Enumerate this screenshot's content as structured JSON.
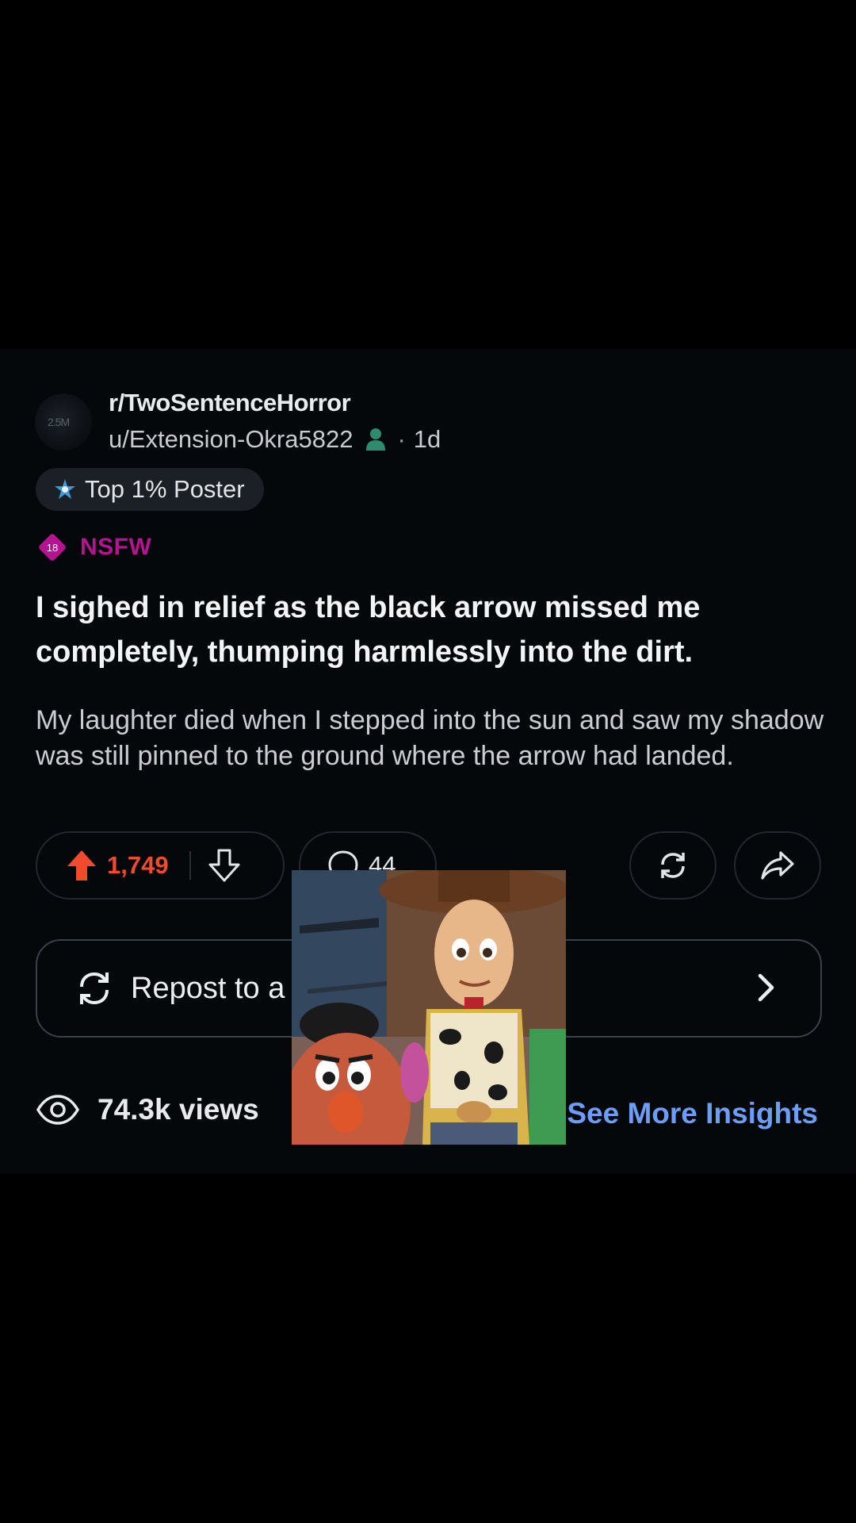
{
  "post": {
    "avatar_text": "2.5M",
    "subreddit": "r/TwoSentenceHorror",
    "username": "u/Extension-Okra5822",
    "age": "1d",
    "flair": "Top 1% Poster",
    "nsfw_badge": "18",
    "nsfw_label": "NSFW",
    "title": "I sighed in relief as the black arrow missed me completely, thumping harmlessly into the dirt.",
    "body": "My laughter died when I stepped into the sun and saw my shadow was still pinned to the ground where the arrow had landed."
  },
  "actions": {
    "upvotes": "1,749",
    "comments": "44"
  },
  "repost": {
    "label": "Repost to a community"
  },
  "insights": {
    "views": "74.3k views",
    "link": "See More Insights"
  },
  "colors": {
    "upvote": "#f04b2c",
    "nsfw": "#b5138f",
    "link": "#6c9ef8",
    "online": "#2e8b6e"
  }
}
